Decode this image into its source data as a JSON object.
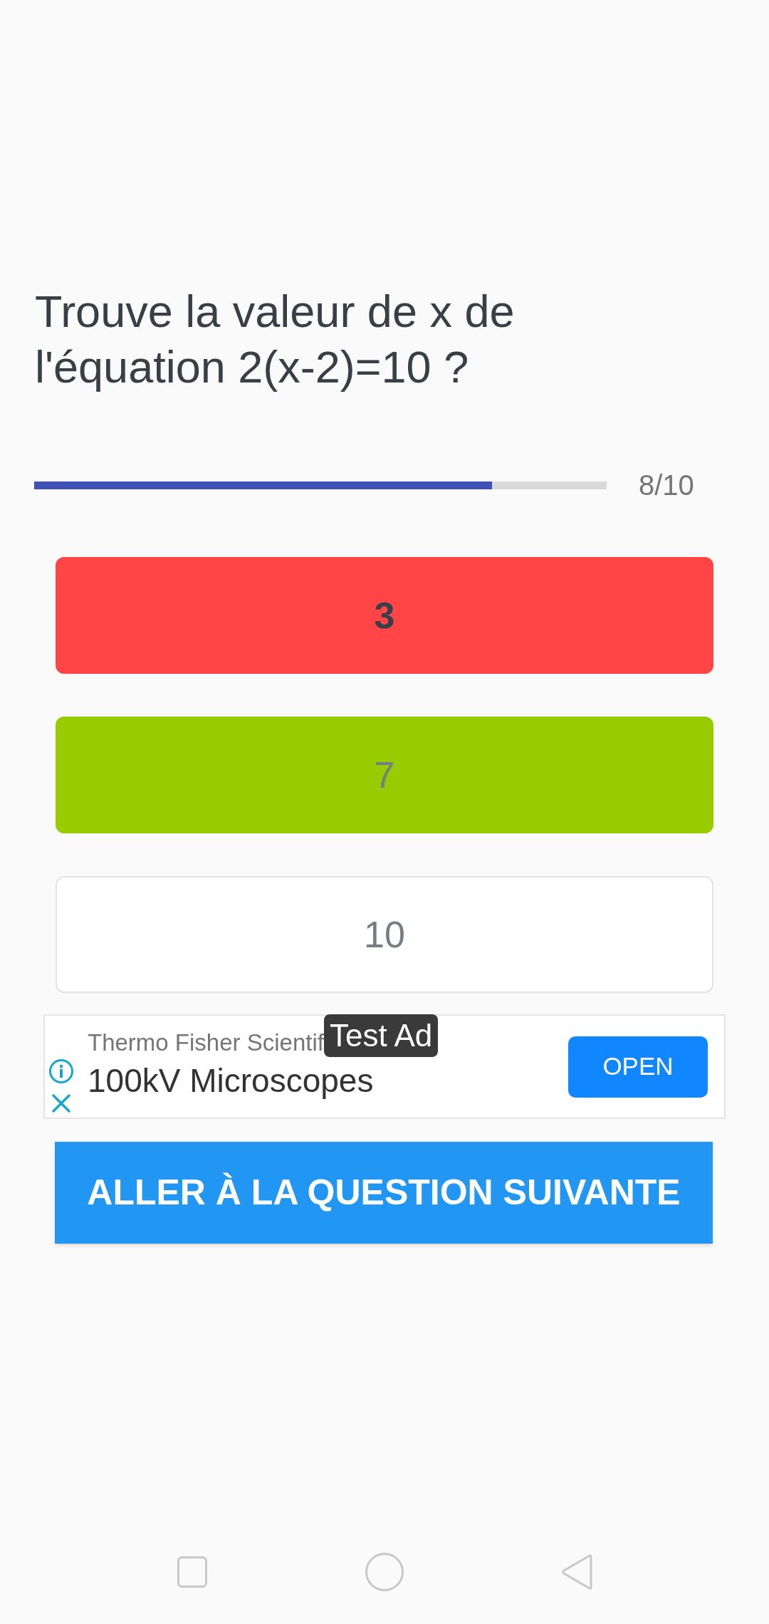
{
  "question": {
    "text": "Trouve la valeur de x de l'équation 2(x-2)=10 ?"
  },
  "progress": {
    "level": 0.8,
    "label": "8/10"
  },
  "answers": [
    {
      "label": "3",
      "selected": true,
      "kind": "wrong"
    },
    {
      "label": "7",
      "selected": false,
      "kind": "correct"
    },
    {
      "label": "10",
      "selected": false,
      "kind": "plain"
    }
  ],
  "ad": {
    "advertiser": "Thermo Fisher Scientif",
    "badge": "Test Ad",
    "headline": "100kV Microscopes",
    "button": "OPEN"
  },
  "next_button": {
    "label": "ALLER À LA QUESTION SUIVANTE"
  }
}
